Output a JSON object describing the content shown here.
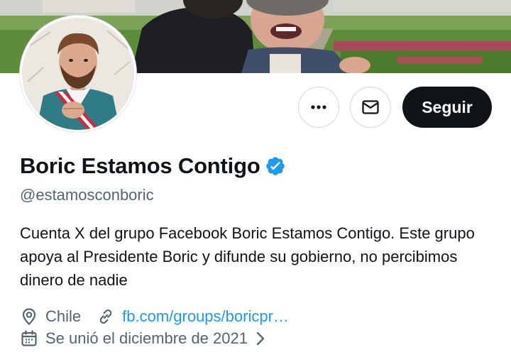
{
  "profile": {
    "display_name": "Boric Estamos Contigo",
    "handle": "@estamosconboric",
    "bio": "Cuenta X del grupo Facebook Boric Estamos Contigo. Este grupo apoya al Presidente Boric y difunde su gobierno, no percibimos dinero de nadie",
    "verified": true
  },
  "actions": {
    "more_icon": "more-horizontal-icon",
    "message_icon": "mail-icon",
    "follow_label": "Seguir"
  },
  "meta": {
    "location_icon": "location-pin-icon",
    "location": "Chile",
    "link_icon": "link-icon",
    "link": "fb.com/groups/boricpr…",
    "joined_icon": "calendar-icon",
    "joined": "Se unió el diciembre de 2021"
  },
  "colors": {
    "accent": "#1d9bf0",
    "follow_button_bg": "#0f1419",
    "secondary_text": "#536471"
  }
}
